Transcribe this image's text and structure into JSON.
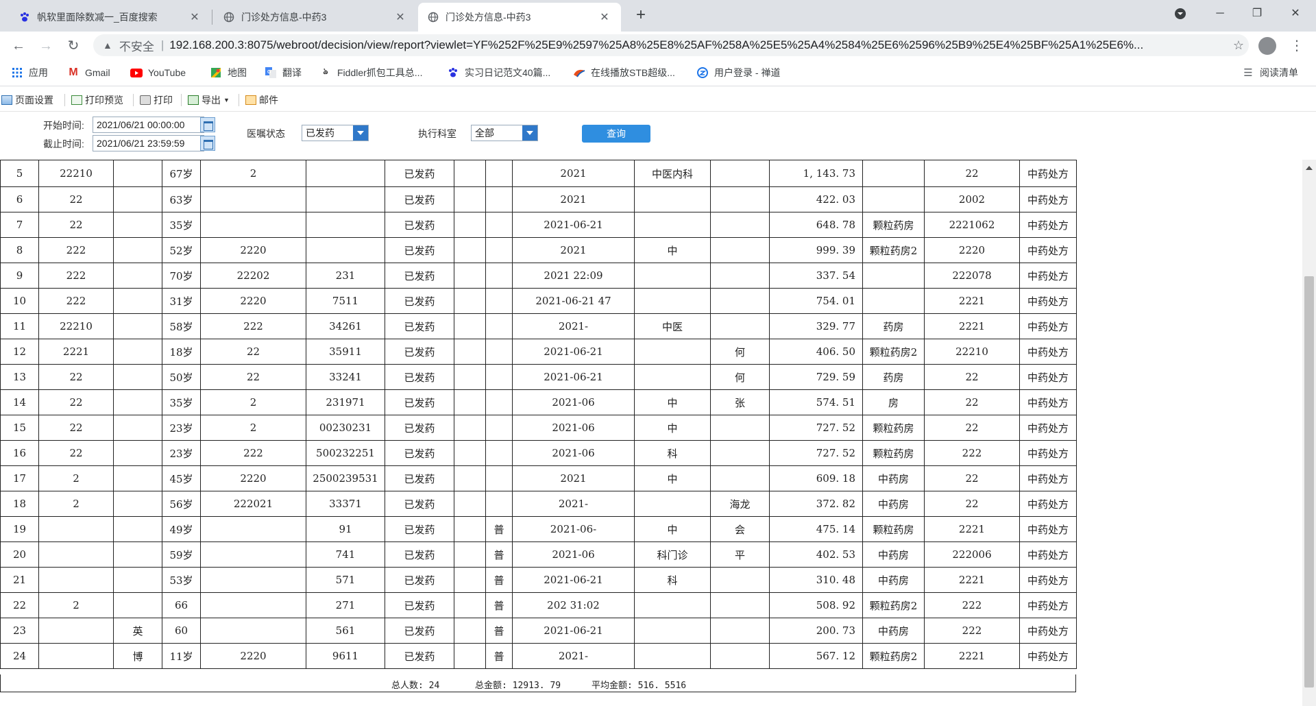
{
  "browser": {
    "tabs": [
      {
        "title": "帆软里面除数减一_百度搜索",
        "icon": "paw-icon",
        "active": false
      },
      {
        "title": "门诊处方信息-中药3",
        "icon": "globe-icon",
        "active": false
      },
      {
        "title": "门诊处方信息-中药3",
        "icon": "globe-icon",
        "active": true
      }
    ],
    "security_label": "不安全",
    "url": "192.168.200.3:8075/webroot/decision/view/report?viewlet=YF%252F%25E9%2597%25A8%25E8%25AF%258A%25E5%25A4%2584%25E6%2596%25B9%25E4%25BF%25A1%25E6%...",
    "bookmarks": [
      {
        "label": "应用",
        "icon": "apps-grid-icon"
      },
      {
        "label": "Gmail",
        "icon": "gmail-icon"
      },
      {
        "label": "YouTube",
        "icon": "youtube-icon"
      },
      {
        "label": "地图",
        "icon": "maps-icon"
      },
      {
        "label": "翻译",
        "icon": "translate-icon"
      },
      {
        "label": "Fiddler抓包工具总...",
        "icon": "fiddler-icon"
      },
      {
        "label": "实习日记范文40篇...",
        "icon": "paw-icon"
      },
      {
        "label": "在线播放STB超级...",
        "icon": "stb-icon"
      },
      {
        "label": "用户登录 - 禅道",
        "icon": "zentao-icon"
      }
    ],
    "reading_list": "阅读清单"
  },
  "toolbar": {
    "page_setup": "页面设置",
    "print_preview": "打印预览",
    "print": "打印",
    "export": "导出",
    "mail": "邮件"
  },
  "query": {
    "start_label": "开始时间:",
    "start_value": "2021/06/21 00:00:00",
    "end_label": "截止时间:",
    "end_value": "2021/06/21 23:59:59",
    "status_label": "医嘱状态",
    "status_value": "已发药",
    "dept_label": "执行科室",
    "dept_value": "全部",
    "query_button": "查询"
  },
  "table": {
    "rows": [
      {
        "no": "5",
        "id": "22210",
        "name": "",
        "age": "67岁",
        "card": "2",
        "code": "",
        "status": "已发药",
        "type": "",
        "time": "2021",
        "dept": "中医内科",
        "doctor": "",
        "amount": "1, 143. 73",
        "pharmacy": "",
        "rxno": "22",
        "category": "中药处方"
      },
      {
        "no": "6",
        "id": "22",
        "name": "",
        "age": "63岁",
        "card": "",
        "code": "",
        "status": "已发药",
        "type": "",
        "time": "2021",
        "dept": "",
        "doctor": "",
        "amount": "422. 03",
        "pharmacy": "",
        "rxno": "2002",
        "category": "中药处方"
      },
      {
        "no": "7",
        "id": "22",
        "name": "",
        "age": "35岁",
        "card": "",
        "code": "",
        "status": "已发药",
        "type": "",
        "time": "2021-06-21",
        "dept": "",
        "doctor": "",
        "amount": "648. 78",
        "pharmacy": "颗粒药房",
        "rxno": "2221062",
        "category": "中药处方"
      },
      {
        "no": "8",
        "id": "222",
        "name": "",
        "age": "52岁",
        "card": "2220",
        "code": "",
        "status": "已发药",
        "type": "",
        "time": "2021",
        "dept": "中",
        "doctor": "",
        "amount": "999. 39",
        "pharmacy": "颗粒药房2",
        "rxno": "2220",
        "category": "中药处方"
      },
      {
        "no": "9",
        "id": "222",
        "name": "",
        "age": "70岁",
        "card": "22202",
        "code": "231",
        "status": "已发药",
        "type": "",
        "time": "2021 22:09",
        "dept": "",
        "doctor": "",
        "amount": "337. 54",
        "pharmacy": "",
        "rxno": "222078",
        "category": "中药处方"
      },
      {
        "no": "10",
        "id": "222",
        "name": "",
        "age": "31岁",
        "card": "2220",
        "code": "7511",
        "status": "已发药",
        "type": "",
        "time": "2021-06-21 47",
        "dept": "",
        "doctor": "",
        "amount": "754. 01",
        "pharmacy": "",
        "rxno": "2221",
        "category": "中药处方"
      },
      {
        "no": "11",
        "id": "22210",
        "name": "",
        "age": "58岁",
        "card": "222",
        "code": "34261",
        "status": "已发药",
        "type": "",
        "time": "2021-",
        "dept": "中医",
        "doctor": "",
        "amount": "329. 77",
        "pharmacy": "药房",
        "rxno": "2221",
        "category": "中药处方"
      },
      {
        "no": "12",
        "id": "2221",
        "name": "",
        "age": "18岁",
        "card": "22",
        "code": "35911",
        "status": "已发药",
        "type": "",
        "time": "2021-06-21",
        "dept": "",
        "doctor": "何",
        "amount": "406. 50",
        "pharmacy": "颗粒药房2",
        "rxno": "22210",
        "category": "中药处方"
      },
      {
        "no": "13",
        "id": "22",
        "name": "",
        "age": "50岁",
        "card": "22",
        "code": "33241",
        "status": "已发药",
        "type": "",
        "time": "2021-06-21",
        "dept": "",
        "doctor": "何",
        "amount": "729. 59",
        "pharmacy": "药房",
        "rxno": "22",
        "category": "中药处方"
      },
      {
        "no": "14",
        "id": "22",
        "name": "",
        "age": "35岁",
        "card": "2",
        "code": "231971",
        "status": "已发药",
        "type": "",
        "time": "2021-06",
        "dept": "中",
        "doctor": "张",
        "amount": "574. 51",
        "pharmacy": "房",
        "rxno": "22",
        "category": "中药处方"
      },
      {
        "no": "15",
        "id": "22",
        "name": "",
        "age": "23岁",
        "card": "2",
        "code": "00230231",
        "status": "已发药",
        "type": "",
        "time": "2021-06",
        "dept": "中",
        "doctor": "",
        "amount": "727. 52",
        "pharmacy": "颗粒药房",
        "rxno": "22",
        "category": "中药处方"
      },
      {
        "no": "16",
        "id": "22",
        "name": "",
        "age": "23岁",
        "card": "222",
        "code": "500232251",
        "status": "已发药",
        "type": "",
        "time": "2021-06",
        "dept": "科",
        "doctor": "",
        "amount": "727. 52",
        "pharmacy": "颗粒药房",
        "rxno": "222",
        "category": "中药处方"
      },
      {
        "no": "17",
        "id": "2",
        "name": "",
        "age": "45岁",
        "card": "2220",
        "code": "2500239531",
        "status": "已发药",
        "type": "",
        "time": "2021",
        "dept": "中",
        "doctor": "",
        "amount": "609. 18",
        "pharmacy": "中药房",
        "rxno": "22",
        "category": "中药处方"
      },
      {
        "no": "18",
        "id": "2",
        "name": "",
        "age": "56岁",
        "card": "222021",
        "code": "33371",
        "status": "已发药",
        "type": "",
        "time": "2021-",
        "dept": "",
        "doctor": "海龙",
        "amount": "372. 82",
        "pharmacy": "中药房",
        "rxno": "22",
        "category": "中药处方"
      },
      {
        "no": "19",
        "id": "",
        "name": "",
        "age": "49岁",
        "card": "",
        "code": "91",
        "status": "已发药",
        "type": "普",
        "time": "2021-06-",
        "dept": "中",
        "doctor": "会",
        "amount": "475. 14",
        "pharmacy": "颗粒药房",
        "rxno": "2221",
        "category": "中药处方"
      },
      {
        "no": "20",
        "id": "",
        "name": "",
        "age": "59岁",
        "card": "",
        "code": "741",
        "status": "已发药",
        "type": "普",
        "time": "2021-06",
        "dept": "科门诊",
        "doctor": "平",
        "amount": "402. 53",
        "pharmacy": "中药房",
        "rxno": "222006",
        "category": "中药处方"
      },
      {
        "no": "21",
        "id": "",
        "name": "",
        "age": "53岁",
        "card": "",
        "code": "571",
        "status": "已发药",
        "type": "普",
        "time": "2021-06-21",
        "dept": "科",
        "doctor": "",
        "amount": "310. 48",
        "pharmacy": "中药房",
        "rxno": "2221",
        "category": "中药处方"
      },
      {
        "no": "22",
        "id": "2",
        "name": "",
        "age": "66",
        "card": "",
        "code": "271",
        "status": "已发药",
        "type": "普",
        "time": "202 31:02",
        "dept": "",
        "doctor": "",
        "amount": "508. 92",
        "pharmacy": "颗粒药房2",
        "rxno": "222",
        "category": "中药处方"
      },
      {
        "no": "23",
        "id": "",
        "name": "英",
        "age": "60",
        "card": "",
        "code": "561",
        "status": "已发药",
        "type": "普",
        "time": "2021-06-21",
        "dept": "",
        "doctor": "",
        "amount": "200. 73",
        "pharmacy": "中药房",
        "rxno": "222",
        "category": "中药处方"
      },
      {
        "no": "24",
        "id": "",
        "name": "博",
        "age": "11岁",
        "card": "2220",
        "code": "9611",
        "status": "已发药",
        "type": "普",
        "time": "2021-",
        "dept": "",
        "doctor": "",
        "amount": "567. 12",
        "pharmacy": "颗粒药房2",
        "rxno": "2221",
        "category": "中药处方"
      }
    ],
    "summary": {
      "total_people": "总人数: 24",
      "total_amount": "总金额: 12913. 79",
      "avg_amount": "平均金额: 516. 5516"
    }
  }
}
